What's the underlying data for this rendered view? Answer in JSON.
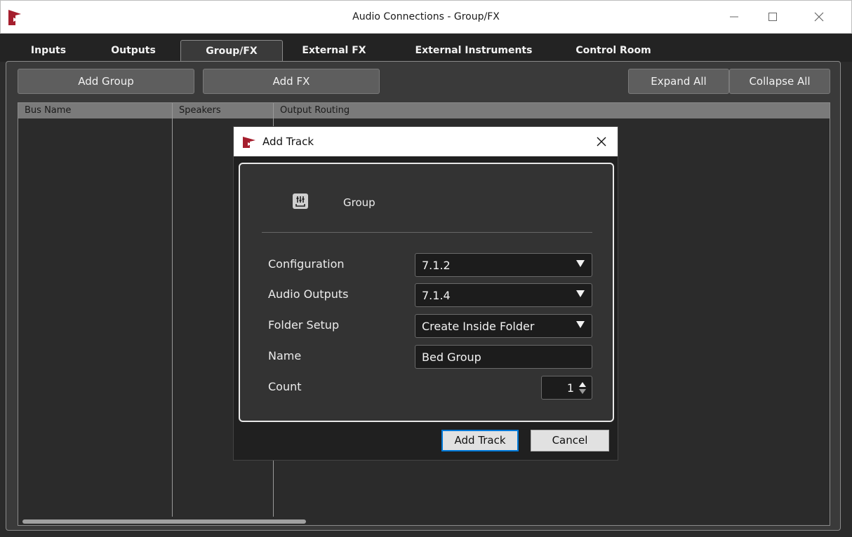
{
  "window": {
    "title": "Audio Connections - Group/FX"
  },
  "tabs": [
    {
      "label": "Inputs"
    },
    {
      "label": "Outputs"
    },
    {
      "label": "Group/FX"
    },
    {
      "label": "External FX"
    },
    {
      "label": "External Instruments"
    },
    {
      "label": "Control Room"
    }
  ],
  "active_tab": "Group/FX",
  "toolbar": {
    "add_group": "Add Group",
    "add_fx": "Add FX",
    "expand_all": "Expand All",
    "collapse_all": "Collapse All"
  },
  "grid": {
    "columns": [
      "Bus Name",
      "Speakers",
      "Output Routing"
    ]
  },
  "dialog": {
    "title": "Add Track",
    "track_type": "Group",
    "fields": {
      "configuration": {
        "label": "Configuration",
        "value": "7.1.2"
      },
      "audio_outputs": {
        "label": "Audio Outputs",
        "value": "7.1.4"
      },
      "folder_setup": {
        "label": "Folder Setup",
        "value": "Create Inside Folder"
      },
      "name": {
        "label": "Name",
        "value": "Bed Group"
      },
      "count": {
        "label": "Count",
        "value": "1"
      }
    },
    "buttons": {
      "add_track": "Add Track",
      "cancel": "Cancel"
    }
  },
  "colors": {
    "brand": "#a51e2d",
    "focus": "#0078d7"
  }
}
